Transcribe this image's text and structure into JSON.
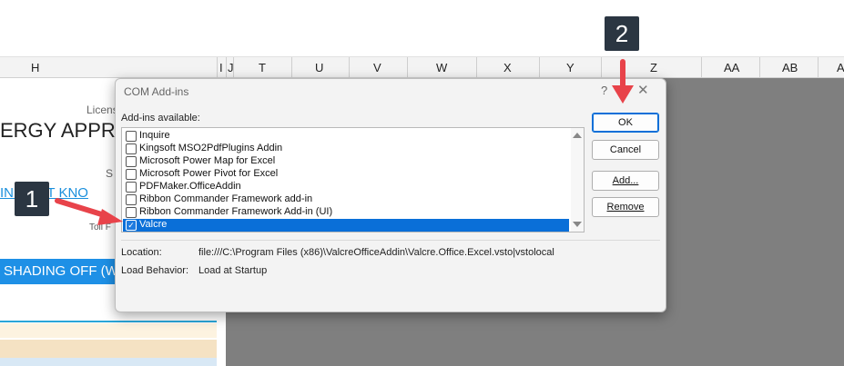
{
  "columns": [
    "H",
    "I",
    "J",
    "T",
    "U",
    "V",
    "W",
    "X",
    "Y",
    "Z",
    "AA",
    "AB",
    "A"
  ],
  "sheet": {
    "licence_text": "Licens",
    "heading_text": "ERGY APPRAIS",
    "s_text": "S",
    "link_text": "IN  PORT KNO",
    "toll_text": "Toll F",
    "blue_bar_text": "SHADING OFF (WI"
  },
  "dialog": {
    "title": "COM Add-ins",
    "help": "?",
    "close": "✕",
    "addins_label": "Add-ins available:",
    "items": [
      {
        "label": "Inquire",
        "checked": false,
        "selected": false
      },
      {
        "label": "Kingsoft MSO2PdfPlugins Addin",
        "checked": false,
        "selected": false
      },
      {
        "label": "Microsoft Power Map for Excel",
        "checked": false,
        "selected": false
      },
      {
        "label": "Microsoft Power Pivot for Excel",
        "checked": false,
        "selected": false
      },
      {
        "label": "PDFMaker.OfficeAddin",
        "checked": false,
        "selected": false
      },
      {
        "label": "Ribbon Commander Framework add-in",
        "checked": false,
        "selected": false
      },
      {
        "label": "Ribbon Commander Framework Add-in (UI)",
        "checked": false,
        "selected": false
      },
      {
        "label": "Valcre",
        "checked": true,
        "selected": true
      }
    ],
    "buttons": {
      "ok": "OK",
      "cancel": "Cancel",
      "add": "Add...",
      "remove": "Remove"
    },
    "location_label": "Location:",
    "location_value": "file:///C:\\Program Files (x86)\\ValcreOfficeAddin\\Valcre.Office.Excel.vsto|vstolocal",
    "load_behavior_label": "Load Behavior:",
    "load_behavior_value": "Load at Startup"
  },
  "annotations": {
    "badge1": "1",
    "badge2": "2"
  },
  "colors": {
    "accent": "#0a6fd8",
    "arrow": "#e8434a",
    "badge": "#2b3642",
    "sheet_blue": "#1e90e6"
  }
}
